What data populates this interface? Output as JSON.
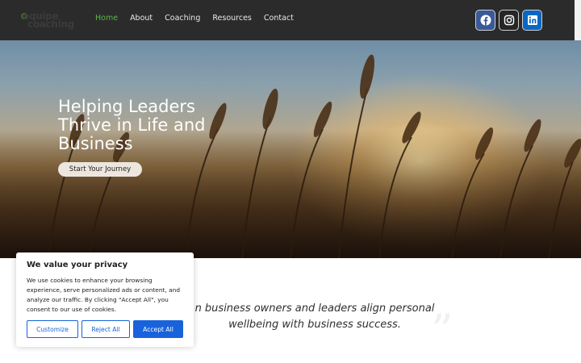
{
  "header": {
    "logo_line1": "equipe",
    "logo_line2": "coaching",
    "nav": [
      {
        "label": "Home",
        "active": true
      },
      {
        "label": "About",
        "active": false
      },
      {
        "label": "Coaching",
        "active": false
      },
      {
        "label": "Resources",
        "active": false
      },
      {
        "label": "Contact",
        "active": false
      }
    ],
    "socials": [
      {
        "icon": "facebook-icon",
        "color": "#3b5998"
      },
      {
        "icon": "instagram-icon",
        "color": "#262626"
      },
      {
        "icon": "linkedin-icon",
        "color": "#0a66c2"
      }
    ],
    "active_color": "#5fb548"
  },
  "hero": {
    "title_lines": [
      "Helping Leaders",
      "Thrive in Life and",
      "Business"
    ],
    "cta_label": "Start Your Journey"
  },
  "mission": {
    "line1": "n business owners and leaders align personal",
    "line2": "wellbeing with business success."
  },
  "cookie": {
    "title": "We value your privacy",
    "body": "We use cookies to enhance your browsing experience, serve personalized ads or content, and analyze our traffic. By clicking \"Accept All\", you consent to our use of cookies.",
    "customize_label": "Customize",
    "reject_label": "Reject All",
    "accept_label": "Accept All",
    "accent_color": "#1863dc"
  }
}
